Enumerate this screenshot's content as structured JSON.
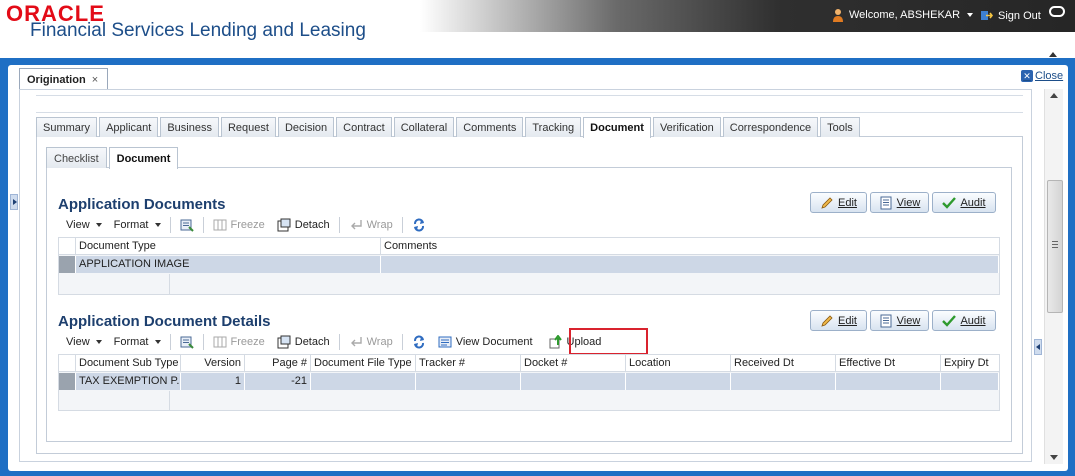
{
  "header": {
    "logo": "ORACLE",
    "app_name": "Financial Services Lending and Leasing",
    "welcome": "Welcome, ABSHEKAR",
    "sign_out": "Sign Out"
  },
  "workspace": {
    "tab_label": "Origination",
    "tab_close": "×",
    "close_label": "Close"
  },
  "main_tabs": [
    "Summary",
    "Applicant",
    "Business",
    "Request",
    "Decision",
    "Contract",
    "Collateral",
    "Comments",
    "Tracking",
    "Document",
    "Verification",
    "Correspondence",
    "Tools"
  ],
  "main_tab_active": "Document",
  "sub_tabs": [
    "Checklist",
    "Document"
  ],
  "sub_tab_active": "Document",
  "actions": {
    "edit": "Edit",
    "view": "View",
    "audit": "Audit"
  },
  "toolbar": {
    "view": "View",
    "format": "Format",
    "freeze": "Freeze",
    "detach": "Detach",
    "wrap": "Wrap",
    "view_document": "View Document",
    "upload": "Upload"
  },
  "app_docs": {
    "title": "Application Documents",
    "columns": [
      "Document Type",
      "Comments"
    ],
    "rows": [
      [
        "APPLICATION IMAGE",
        ""
      ]
    ]
  },
  "doc_details": {
    "title": "Application Document Details",
    "columns": [
      "Document Sub Type",
      "Version",
      "Page #",
      "Document File Type",
      "Tracker #",
      "Docket #",
      "Location",
      "Received Dt",
      "Effective Dt",
      "Expiry Dt"
    ],
    "rows": [
      [
        "TAX EXEMPTION P...",
        "1",
        "-21",
        "",
        "",
        "",
        "",
        "",
        "",
        ""
      ]
    ]
  },
  "colors": {
    "brand_red": "#e30b17",
    "brand_blue": "#1d4e89",
    "frame_blue": "#1f6fc4",
    "row_selected": "#cdd7e6",
    "highlight": "#d9232e"
  }
}
